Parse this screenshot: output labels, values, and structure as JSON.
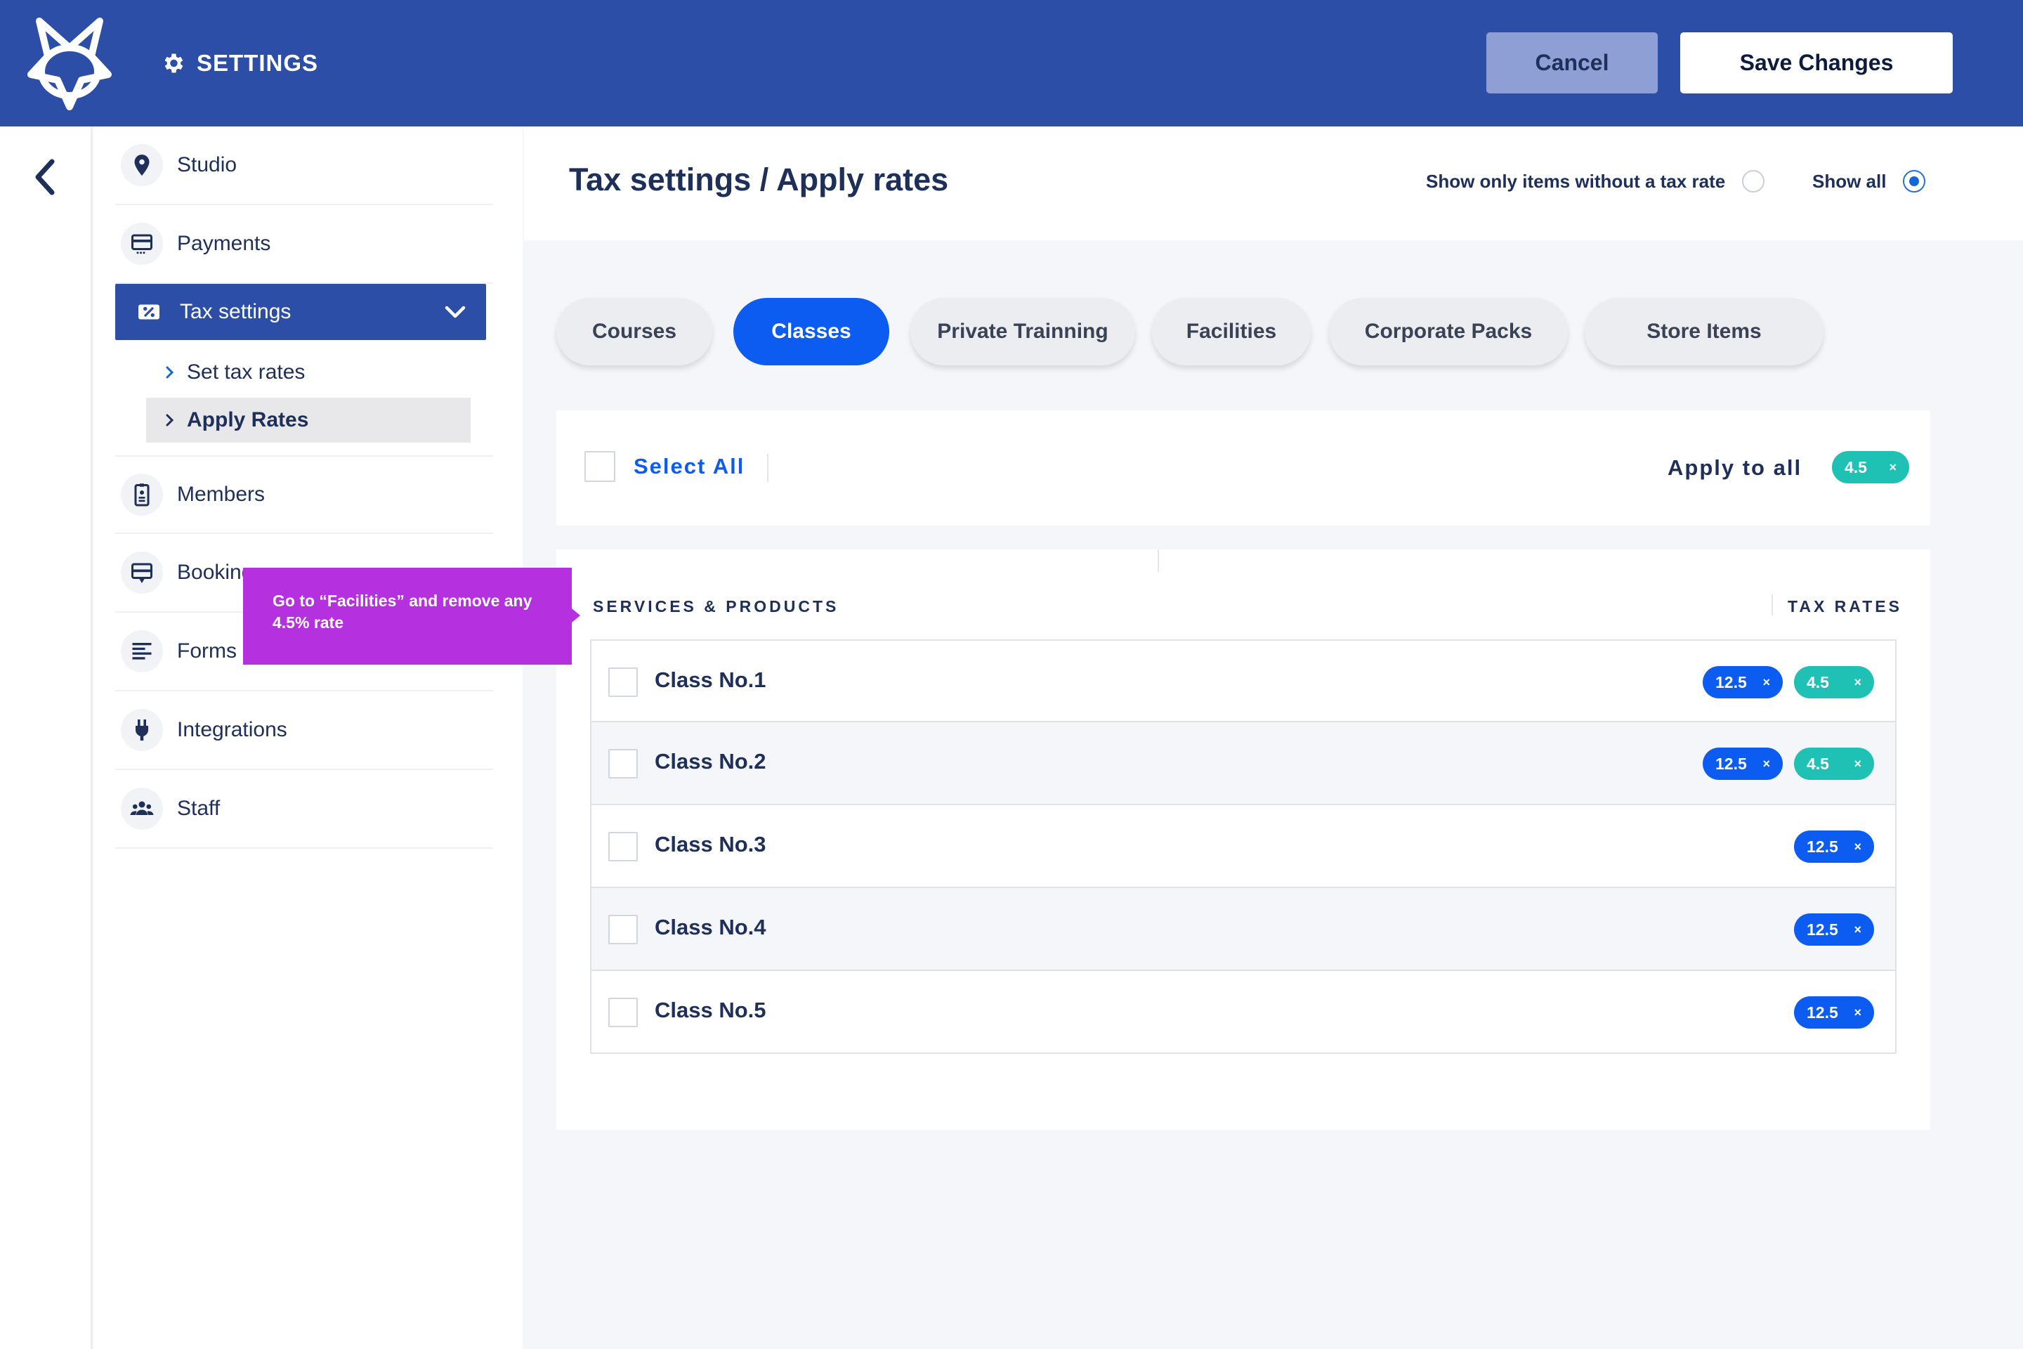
{
  "header": {
    "title": "SETTINGS",
    "cancel_label": "Cancel",
    "save_label": "Save Changes"
  },
  "sidebar": {
    "items": [
      {
        "label": "Studio",
        "icon": "location-pin-icon"
      },
      {
        "label": "Payments",
        "icon": "credit-card-icon"
      },
      {
        "label": "Tax settings",
        "icon": "percent-tag-icon"
      },
      {
        "label": "Members",
        "icon": "id-badge-icon"
      },
      {
        "label": "Bookings",
        "icon": "booking-icon"
      },
      {
        "label": "Forms",
        "icon": "lines-icon"
      },
      {
        "label": "Integrations",
        "icon": "plug-icon"
      },
      {
        "label": "Staff",
        "icon": "people-icon"
      }
    ],
    "sub_items": [
      {
        "label": "Set tax rates"
      },
      {
        "label": "Apply Rates"
      }
    ]
  },
  "page": {
    "title": "Tax settings / Apply rates",
    "filter_without_rate": "Show only items without a tax rate",
    "filter_show_all": "Show all",
    "selected_filter": "Show all"
  },
  "tabs": [
    {
      "label": "Courses"
    },
    {
      "label": "Classes"
    },
    {
      "label": "Private Trainning"
    },
    {
      "label": "Facilities"
    },
    {
      "label": "Corporate Packs"
    },
    {
      "label": "Store Items"
    }
  ],
  "active_tab": "Classes",
  "bulk": {
    "select_all": "Select All",
    "apply_to_all": "Apply to all",
    "apply_rate": "4.5",
    "remove_glyph": "×"
  },
  "table": {
    "col_services": "SERVICES & PRODUCTS",
    "col_rates": "TAX RATES",
    "rows": [
      {
        "name": "Class No.1",
        "rates": [
          "12.5",
          "4.5"
        ]
      },
      {
        "name": "Class No.2",
        "rates": [
          "12.5",
          "4.5"
        ]
      },
      {
        "name": "Class No.3",
        "rates": [
          "12.5"
        ]
      },
      {
        "name": "Class No.4",
        "rates": [
          "12.5"
        ]
      },
      {
        "name": "Class No.5",
        "rates": [
          "12.5"
        ]
      }
    ]
  },
  "tooltip": {
    "text": "Go to  “Facilities” and remove any 4.5% rate"
  },
  "colors": {
    "header_bg": "#2c4ea6",
    "accent_blue": "#0d5cf2",
    "teal": "#1fc1b5",
    "tooltip": "#b531e0"
  }
}
